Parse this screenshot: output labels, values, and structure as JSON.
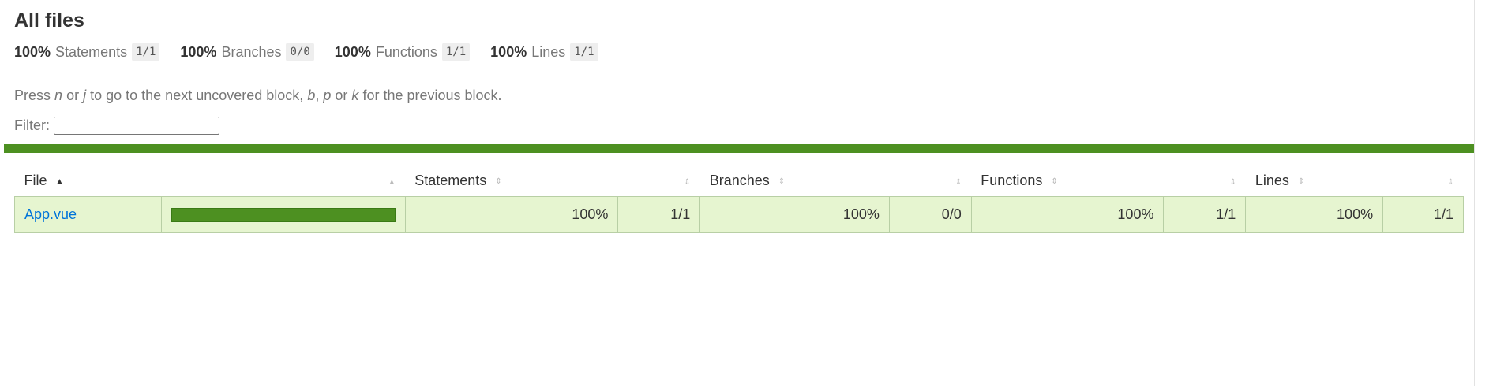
{
  "title": "All files",
  "summary": [
    {
      "pct": "100%",
      "label": "Statements",
      "fraction": "1/1"
    },
    {
      "pct": "100%",
      "label": "Branches",
      "fraction": "0/0"
    },
    {
      "pct": "100%",
      "label": "Functions",
      "fraction": "1/1"
    },
    {
      "pct": "100%",
      "label": "Lines",
      "fraction": "1/1"
    }
  ],
  "hint": {
    "press": "Press",
    "key_n": "n",
    "or1": "or",
    "key_j": "j",
    "mid": "to go to the next uncovered block,",
    "key_b": "b",
    "comma": ",",
    "key_p": "p",
    "or2": "or",
    "key_k": "k",
    "end": "for the previous block."
  },
  "filter": {
    "label": "Filter:",
    "value": ""
  },
  "status_color": "#4d9021",
  "table": {
    "headers": {
      "file": "File",
      "statements": "Statements",
      "branches": "Branches",
      "functions": "Functions",
      "lines": "Lines"
    },
    "rows": [
      {
        "file": "App.vue",
        "coverage_fraction": 1.0,
        "statements_pct": "100%",
        "statements_frac": "1/1",
        "branches_pct": "100%",
        "branches_frac": "0/0",
        "functions_pct": "100%",
        "functions_frac": "1/1",
        "lines_pct": "100%",
        "lines_frac": "1/1"
      }
    ]
  }
}
